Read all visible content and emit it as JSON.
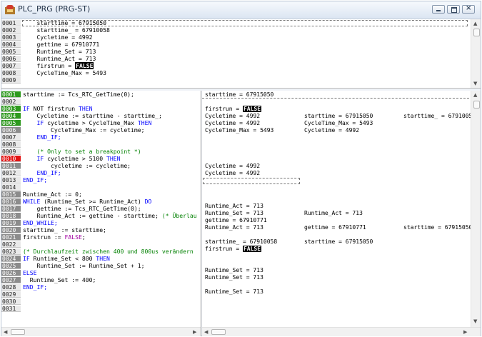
{
  "window": {
    "title": "PLC_PRG (PRG-ST)",
    "buttons": [
      "minimize",
      "maximize",
      "close"
    ]
  },
  "declarations": {
    "lines": [
      {
        "no": "0001",
        "text": "    starttime = 67915050"
      },
      {
        "no": "0002",
        "text": "    starttime_ = 67910058"
      },
      {
        "no": "0003",
        "text": "    Cycletime = 4992"
      },
      {
        "no": "0004",
        "text": "    gettime = 67910771"
      },
      {
        "no": "0005",
        "text": "    Runtime_Set = 713"
      },
      {
        "no": "0006",
        "text": "    Runtime_Act = 713"
      },
      {
        "no": "0007",
        "text": "    firstrun = ",
        "bool": "FALSE"
      },
      {
        "no": "0008",
        "text": "    CycleTime_Max = 5493"
      },
      {
        "no": "0009",
        "text": ""
      }
    ]
  },
  "code": {
    "gutter": [
      {
        "no": "0001",
        "state": "g"
      },
      {
        "no": "0002",
        "state": "w"
      },
      {
        "no": "0003",
        "state": "g"
      },
      {
        "no": "0004",
        "state": "g"
      },
      {
        "no": "0005",
        "state": "g"
      },
      {
        "no": "0006",
        "state": "d"
      },
      {
        "no": "0007",
        "state": "w"
      },
      {
        "no": "0008",
        "state": "w"
      },
      {
        "no": "0009",
        "state": "w"
      },
      {
        "no": "0010",
        "state": "r"
      },
      {
        "no": "0011",
        "state": "d"
      },
      {
        "no": "0012",
        "state": "w"
      },
      {
        "no": "0013",
        "state": "w"
      },
      {
        "no": "0014",
        "state": "w"
      },
      {
        "no": "0015",
        "state": "d"
      },
      {
        "no": "0016",
        "state": "d"
      },
      {
        "no": "0017",
        "state": "d"
      },
      {
        "no": "0018",
        "state": "d"
      },
      {
        "no": "0019",
        "state": "d"
      },
      {
        "no": "0020",
        "state": "d"
      },
      {
        "no": "0021",
        "state": "d"
      },
      {
        "no": "0022",
        "state": "w"
      },
      {
        "no": "0023",
        "state": "w"
      },
      {
        "no": "0024",
        "state": "d"
      },
      {
        "no": "0025",
        "state": "d"
      },
      {
        "no": "0026",
        "state": "d"
      },
      {
        "no": "0027",
        "state": "d"
      },
      {
        "no": "0028",
        "state": "w"
      },
      {
        "no": "0029",
        "state": "w"
      },
      {
        "no": "0030",
        "state": "w"
      },
      {
        "no": "0031",
        "state": "w"
      }
    ],
    "lines": {
      "l01": "starttime := Tcs_RTC_GetTime(0);",
      "l03a": "IF",
      "l03b": " NOT firstrun ",
      "l03c": "THEN",
      "l04": "    Cycletime := starttime - starttime_;",
      "l05a": "    IF",
      "l05b": " cycletime > CycleTime_Max ",
      "l05c": "THEN",
      "l06": "        CycleTime_Max := cycletime;",
      "l07": "    END_IF;",
      "l09": "    (* Only to set a breakpoint *)",
      "l10a": "    IF",
      "l10b": " cycletime > 5100 ",
      "l10c": "THEN",
      "l11": "        cycletime := cycletime;",
      "l12": "    END_IF;",
      "l13": "END_IF;",
      "l15": "Runtime_Act := 0;",
      "l16a": "WHILE",
      "l16b": " (Runtime_Set >= Runtime_Act) ",
      "l16c": "DO",
      "l17": "    gettime := Tcs_RTC_GetTime(0);",
      "l18a": "    Runtime_Act := gettime - starttime; ",
      "l18b": "(* Überlau",
      "l19": "END_WHILE;",
      "l20": "starttime_ := starttime;",
      "l21a": "firstrun := ",
      "l21b": "FALSE",
      "l21c": ";",
      "l23": "(* Durchlaufzeit zwischen 400 und 800us verändern",
      "l24a": "IF",
      "l24b": " Runtime_Set < 800 ",
      "l24c": "THEN",
      "l25": "    Runtime_Set := Runtime_Set + 1;",
      "l26": "ELSE",
      "l27": "  Runtime_Set := 400;",
      "l28": "END_IF;"
    }
  },
  "monitor": {
    "m01": "starttime = 67915050",
    "m03a": "firstrun = ",
    "m03b": "FALSE",
    "m04a": "Cycletime = 4992",
    "m04b": "starttime = 67915050",
    "m04c": "starttime_ = 6791005",
    "m05a": "Cycletime = 4992",
    "m05b": "CycleTime_Max = 5493",
    "m06a": "CycleTime_Max = 5493",
    "m06b": "Cycletime = 4992",
    "m10": "Cycletime = 4992",
    "m11": "Cycletime = 4992",
    "m15": "Runtime_Act = 713",
    "m16a": "Runtime_Set = 713",
    "m16b": "Runtime_Act = 713",
    "m17": "gettime = 67910771",
    "m18a": "Runtime_Act = 713",
    "m18b": "gettime = 67910771",
    "m18c": "starttime = 67915050",
    "m20a": "starttime_ = 67910058",
    "m20b": "starttime = 67915050",
    "m21a": "firstrun = ",
    "m21b": "FALSE",
    "m24": "Runtime_Set = 713",
    "m25": "Runtime_Set = 713",
    "m27": "Runtime_Set = 713"
  },
  "colors": {
    "gutter_green": "#2d9a1d",
    "gutter_gray": "#8c8c8c",
    "gutter_breakpoint": "#e31212",
    "keyword": "#0000ff",
    "comment": "#008000"
  }
}
